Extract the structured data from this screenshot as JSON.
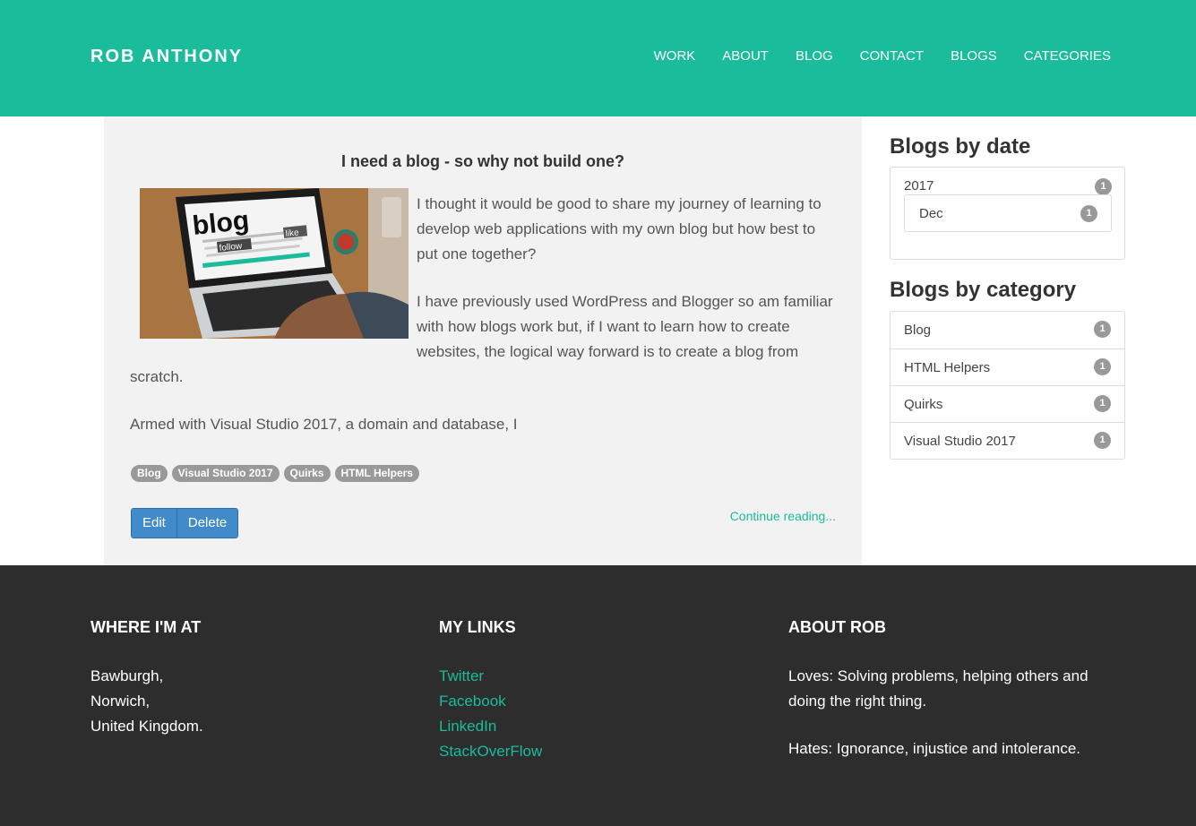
{
  "header": {
    "brand": "ROB ANTHONY",
    "nav": [
      "WORK",
      "ABOUT",
      "BLOG",
      "CONTACT",
      "BLOGS",
      "CATEGORIES"
    ]
  },
  "post": {
    "title": "I need a blog - so why not build one?",
    "paragraphs": [
      "I thought it would be good to share my journey of learning to develop web applications with my own blog but how best to put one together?",
      "I have previously used WordPress and Blogger so am familiar with how blogs work but, if I want to learn how to create websites, the logical way forward is to create a blog from scratch.",
      "Armed with Visual Studio 2017, a domain and database, I"
    ],
    "image_text": {
      "word": "blog",
      "tag_words": "follow",
      "like": "like"
    },
    "tags": [
      "Blog",
      "Visual Studio 2017",
      "Quirks",
      "HTML Helpers"
    ],
    "edit_label": "Edit",
    "delete_label": "Delete",
    "continue_label": "Continue reading..."
  },
  "sidebar": {
    "date_heading": "Blogs by date",
    "year": {
      "label": "2017",
      "count": "1"
    },
    "month": {
      "label": "Dec",
      "count": "1"
    },
    "category_heading": "Blogs by category",
    "categories": [
      {
        "label": "Blog",
        "count": "1"
      },
      {
        "label": "HTML Helpers",
        "count": "1"
      },
      {
        "label": "Quirks",
        "count": "1"
      },
      {
        "label": "Visual Studio 2017",
        "count": "1"
      }
    ]
  },
  "footer": {
    "location": {
      "heading": "WHERE I'M AT",
      "lines": [
        "Bawburgh,",
        "Norwich,",
        "United Kingdom."
      ]
    },
    "links": {
      "heading": "MY LINKS",
      "items": [
        "Twitter",
        "Facebook",
        "LinkedIn",
        "StackOverFlow"
      ]
    },
    "about": {
      "heading": "ABOUT ROB",
      "paragraphs": [
        "Loves: Solving problems, helping others and doing the right thing.",
        "Hates: Ignorance, injustice and intolerance."
      ]
    }
  },
  "colors": {
    "accent": "#1abc9c",
    "footer_bg": "#2d2d2d",
    "panel_bg": "#f2f2f2",
    "button": "#428bca",
    "badge": "#999999"
  }
}
